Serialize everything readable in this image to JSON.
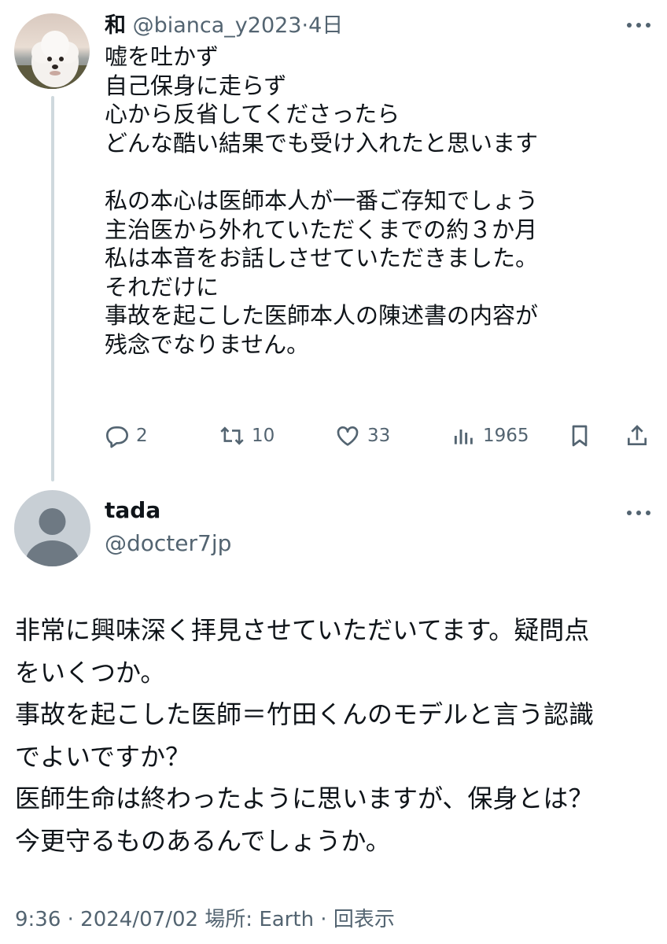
{
  "tweet1": {
    "author_name": "和",
    "handle": "@bianca_y2023",
    "separator": "·",
    "time": "4日",
    "text": "嘘を吐かず\n自己保身に走らず\n心から反省してくださったら\nどんな酷い結果でも受け入れたと思います\n\n私の本心は医師本人が一番ご存知でしょう\n主治医から外れていただくまでの約３か月\n私は本音をお話しさせていただきました。\nそれだけに\n事故を起こした医師本人の陳述書の内容が\n残念でなりません。",
    "replies": "2",
    "retweets": "10",
    "likes": "33",
    "views": "1965",
    "icons": {
      "avatar": "dog-avatar",
      "more": "more-icon",
      "reply": "reply-icon",
      "retweet": "retweet-icon",
      "like": "heart-icon",
      "views": "views-icon",
      "bookmark": "bookmark-icon",
      "share": "share-icon"
    }
  },
  "tweet2": {
    "author_name": "tada",
    "handle": "@docter7jp",
    "text": "非常に興味深く拝見させていただいてます。疑問点\nをいくつか。\n事故を起こした医師＝竹田くんのモデルと言う認識\nでよいですか？\n医師生命は終わったように思いますが、保身とは？\n今更守るものあるんでしょうか。",
    "meta": "9:36 · 2024/07/02 場所: Earth · 回表示",
    "icons": {
      "avatar": "default-avatar",
      "more": "more-icon"
    }
  },
  "colors": {
    "text": "#0f1419",
    "secondary": "#536471",
    "thread_line": "#cfd9de",
    "avatar_gray": "#c8cfd5"
  }
}
